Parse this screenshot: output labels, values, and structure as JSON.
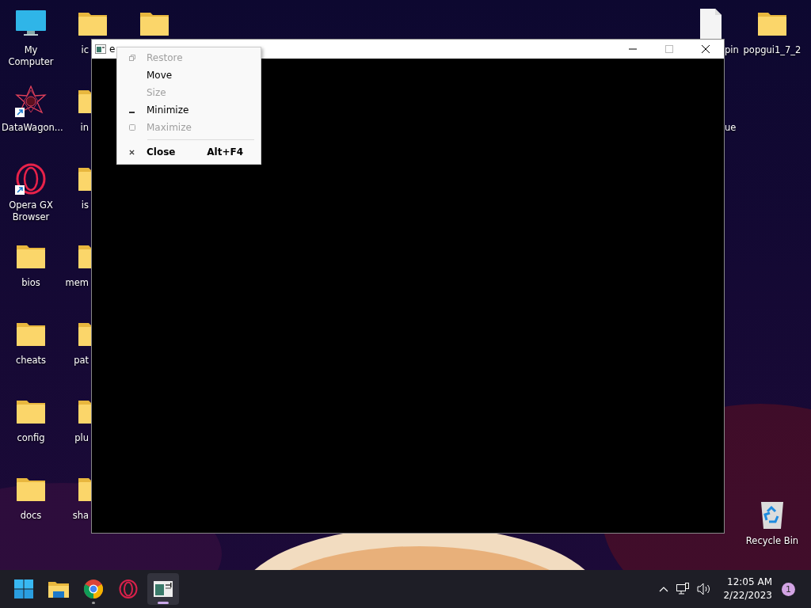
{
  "desktop": {
    "left_columns": [
      [
        {
          "label": "My Computer",
          "kind": "computer",
          "shortcut": false
        },
        {
          "label": "DataWagon...",
          "kind": "star",
          "shortcut": true
        },
        {
          "label": "Opera GX Browser",
          "kind": "opera",
          "shortcut": true
        },
        {
          "label": "bios",
          "kind": "folder",
          "shortcut": false
        },
        {
          "label": "cheats",
          "kind": "folder",
          "shortcut": false
        },
        {
          "label": "config",
          "kind": "folder",
          "shortcut": false
        },
        {
          "label": "docs",
          "kind": "folder",
          "shortcut": false
        }
      ],
      [
        {
          "label": "ic",
          "kind": "folder",
          "shortcut": false
        },
        {
          "label": "in",
          "kind": "folder",
          "shortcut": false
        },
        {
          "label": "is",
          "kind": "folder",
          "shortcut": false
        },
        {
          "label": "mem",
          "kind": "folder",
          "shortcut": false
        },
        {
          "label": "pat",
          "kind": "folder",
          "shortcut": false
        },
        {
          "label": "plu",
          "kind": "folder",
          "shortcut": false
        },
        {
          "label": "sha",
          "kind": "folder",
          "shortcut": false
        }
      ],
      [
        {
          "kind": "folder",
          "shortcut": false
        }
      ]
    ],
    "right_columns": [
      {
        "top": [
          {
            "label": "pin",
            "kind": "file",
            "shortcut": false
          },
          {
            "label": "ue",
            "kind": "none"
          }
        ]
      },
      {
        "top": [
          {
            "label": "popgui1_7_2",
            "kind": "folder",
            "shortcut": false
          }
        ],
        "bottom": [
          {
            "label": "Recycle Bin",
            "kind": "recycle",
            "shortcut": false
          }
        ]
      }
    ]
  },
  "window": {
    "title": "e"
  },
  "system_menu": {
    "items": [
      {
        "label": "Restore",
        "kind": "restore",
        "disabled": true
      },
      {
        "label": "Move",
        "kind": "none",
        "disabled": false
      },
      {
        "label": "Size",
        "kind": "none",
        "disabled": true
      },
      {
        "label": "Minimize",
        "kind": "minimize",
        "disabled": false
      },
      {
        "label": "Maximize",
        "kind": "maximize",
        "disabled": true
      },
      {
        "label": "Close",
        "kind": "close",
        "disabled": false,
        "separator_before": true,
        "default": true,
        "shortcut": "Alt+F4"
      }
    ]
  },
  "taskbar": {
    "apps": [
      {
        "kind": "start",
        "running": false,
        "selected": false
      },
      {
        "kind": "explorer",
        "running": false,
        "selected": false
      },
      {
        "kind": "chrome",
        "running": true,
        "selected": false
      },
      {
        "kind": "opera",
        "running": false,
        "selected": false
      },
      {
        "kind": "epsx",
        "running": true,
        "selected": true
      }
    ],
    "time": "12:05 AM",
    "date": "2/22/2023",
    "notifications": "1"
  }
}
